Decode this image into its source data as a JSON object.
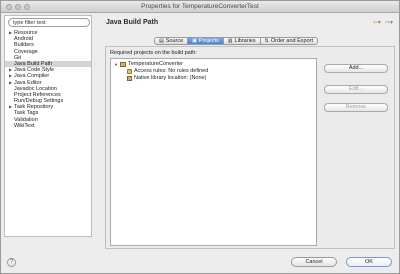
{
  "window": {
    "title": "Properties for TemperatureConverterTest"
  },
  "left": {
    "filter": {
      "value": "type filter text"
    },
    "items": [
      {
        "label": "Resource",
        "has_children": true
      },
      {
        "label": "Android",
        "has_children": false
      },
      {
        "label": "Builders",
        "has_children": false
      },
      {
        "label": "Coverage",
        "has_children": false
      },
      {
        "label": "Git",
        "has_children": false
      },
      {
        "label": "Java Build Path",
        "has_children": false,
        "selected": true
      },
      {
        "label": "Java Code Style",
        "has_children": true
      },
      {
        "label": "Java Compiler",
        "has_children": true
      },
      {
        "label": "Java Editor",
        "has_children": true
      },
      {
        "label": "Javadoc Location",
        "has_children": false
      },
      {
        "label": "Project References",
        "has_children": false
      },
      {
        "label": "Run/Debug Settings",
        "has_children": false
      },
      {
        "label": "Task Repository",
        "has_children": true
      },
      {
        "label": "Task Tags",
        "has_children": false
      },
      {
        "label": "Validation",
        "has_children": false
      },
      {
        "label": "WikiText",
        "has_children": false
      }
    ]
  },
  "header": {
    "title": "Java Build Path",
    "back_icon": "arrow-left-icon",
    "forward_icon": "arrow-right-icon"
  },
  "tabs": [
    {
      "label": "Source",
      "active": false
    },
    {
      "label": "Projects",
      "active": true
    },
    {
      "label": "Libraries",
      "active": false
    },
    {
      "label": "Order and Export",
      "active": false
    }
  ],
  "panel": {
    "label": "Required projects on the build path:",
    "tree": {
      "project": "TemperatureConverter",
      "children": [
        "Access rules: No rules defined",
        "Native library location: (None)"
      ]
    },
    "buttons": [
      {
        "label": "Add...",
        "enabled": true
      },
      {
        "label": "Edit...",
        "enabled": false
      },
      {
        "label": "Remove",
        "enabled": false
      }
    ]
  },
  "footer": {
    "help": "?",
    "cancel": "Cancel",
    "ok": "OK"
  },
  "colors": {
    "active_tab": "#4a82d6",
    "selection": "#d4d4d4"
  }
}
